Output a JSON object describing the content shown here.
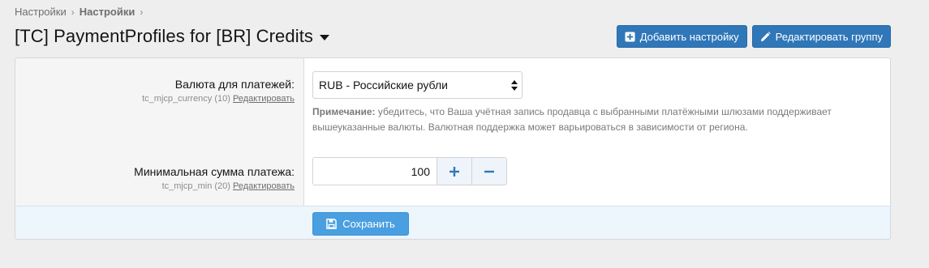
{
  "breadcrumb": {
    "items": [
      "Настройки",
      "Настройки"
    ]
  },
  "page": {
    "title": "[TC] PaymentProfiles for [BR] Credits"
  },
  "actions": {
    "add_setting": "Добавить настройку",
    "edit_group": "Редактировать группу"
  },
  "fields": {
    "currency": {
      "label": "Валюта для платежей:",
      "hint": "tc_mjcp_currency (10)",
      "edit": "Редактировать",
      "value": "RUB - Российские рубли",
      "note_label": "Примечание:",
      "note_text": " убедитесь, что Ваша учётная запись продавца с выбранными платёжными шлюзами поддерживает вышеуказанные валюты. Валютная поддержка может варьироваться в зависимости от региона."
    },
    "min_amount": {
      "label": "Минимальная сумма платежа:",
      "hint": "tc_mjcp_min (20)",
      "edit": "Редактировать",
      "value": "100"
    }
  },
  "footer": {
    "save": "Сохранить"
  },
  "colors": {
    "primary_button": "#2f77b8",
    "save_button": "#4a9fe0",
    "footer_bg": "#edf5fd",
    "stepper_icon": "#2f77b8"
  },
  "icons": {
    "add_setting": "plus-square-icon",
    "edit_group": "pencil-icon",
    "save": "floppy-disk-icon",
    "increment": "plus-icon",
    "decrement": "minus-icon"
  }
}
